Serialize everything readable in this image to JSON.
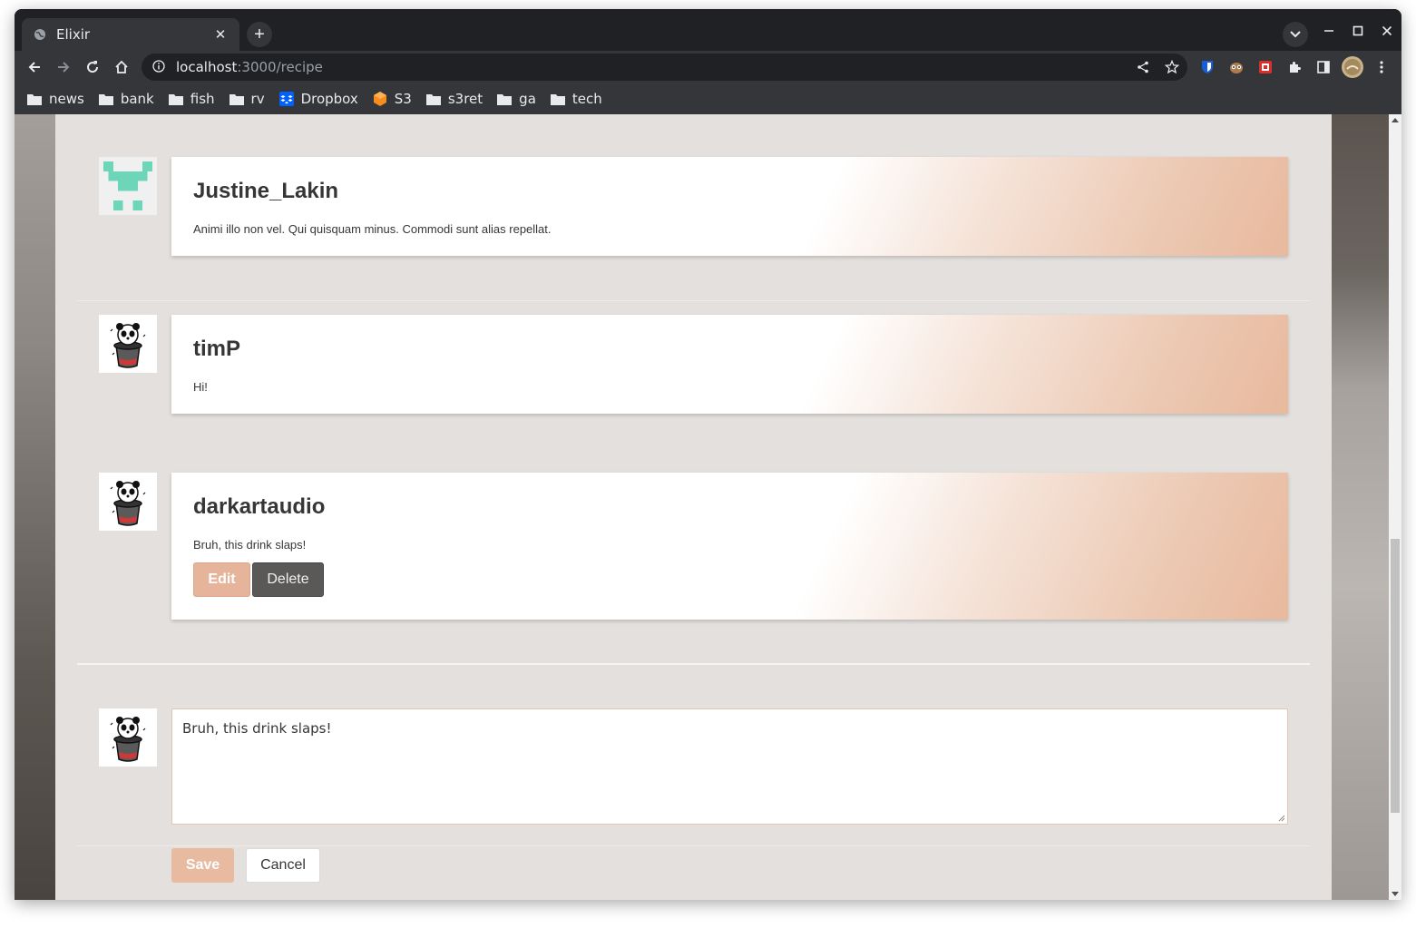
{
  "browser": {
    "tab_title": "Elixir",
    "url_host": "localhost",
    "url_path": ":3000/recipe",
    "bookmarks": [
      {
        "label": "news",
        "icon": "folder-icon"
      },
      {
        "label": "bank",
        "icon": "folder-icon"
      },
      {
        "label": "fish",
        "icon": "folder-icon"
      },
      {
        "label": "rv",
        "icon": "folder-icon"
      },
      {
        "label": "Dropbox",
        "icon": "dropbox-icon"
      },
      {
        "label": "S3",
        "icon": "aws-s3-icon"
      },
      {
        "label": "s3ret",
        "icon": "folder-icon"
      },
      {
        "label": "ga",
        "icon": "folder-icon"
      },
      {
        "label": "tech",
        "icon": "folder-icon"
      }
    ]
  },
  "comments": [
    {
      "author": "Justine_Lakin",
      "text": "Animi illo non vel. Qui quisquam minus. Commodi sunt alias repellat.",
      "avatar": "identicon"
    },
    {
      "author": "timP",
      "text": "Hi!",
      "avatar": "panda-hat"
    },
    {
      "author": "darkartaudio",
      "text": "Bruh, this drink slaps!",
      "avatar": "panda-hat",
      "edit_label": "Edit",
      "delete_label": "Delete"
    }
  ],
  "editor": {
    "value": "Bruh, this drink slaps!",
    "save_label": "Save",
    "cancel_label": "Cancel"
  },
  "colors": {
    "accent": "#e5b49b",
    "delete": "#5b5957",
    "page_bg": "#e4e0dd",
    "identicon": "#6dd5b8"
  }
}
